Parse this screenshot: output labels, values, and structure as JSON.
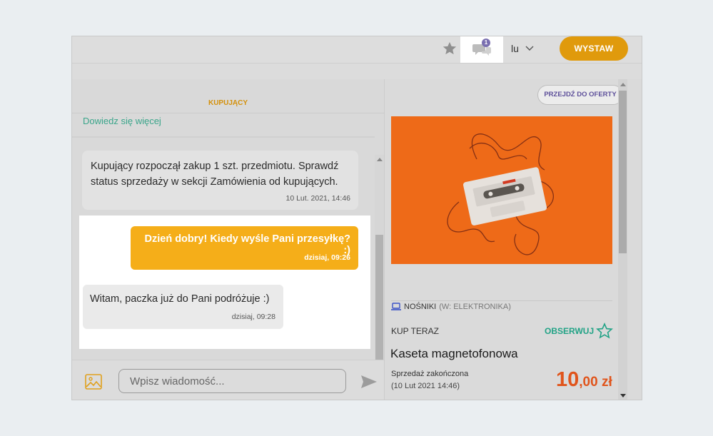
{
  "header": {
    "user_name": "lu",
    "publish_label": "WYSTAW",
    "unread_count": "1",
    "icons": {
      "favorites": "star-icon",
      "messages": "chat-bubbles-icon",
      "user_menu": "chevron-down-icon"
    },
    "accent_color": "#e09a0c"
  },
  "chat": {
    "role_label": "KUPUJĄCY",
    "learn_more_link": "Dowiedz się więcej",
    "system_message": {
      "text": "Kupujący rozpoczął zakup 1 szt. przedmiotu. Sprawdź status sprzedaży w sekcji Zamówienia od kupujących.",
      "time": "10 Lut. 2021, 14:46"
    },
    "messages": [
      {
        "direction": "outgoing",
        "text": "Dzień dobry! Kiedy wyśle Pani przesyłkę? :)",
        "time": "dzisiaj, 09:26"
      },
      {
        "direction": "incoming",
        "text": "Witam, paczka już do Pani podróżuje :)",
        "time": "dzisiaj, 09:28"
      }
    ],
    "composer": {
      "placeholder": "Wpisz wiadomość...",
      "icons": {
        "attach": "image-icon",
        "send": "send-icon"
      }
    }
  },
  "offer": {
    "go_to_offer_label": "PRZEJDŹ DO OFERTY",
    "image": "cassette-tape-photo",
    "category": "NOŚNIKI",
    "category_parent": "(W: ELEKTRONIKA)",
    "buy_type": "KUP TERAZ",
    "watch_label": "OBSERWUJ",
    "title": "Kaseta magnetofonowa",
    "sale_status": "Sprzedaż zakończona",
    "sale_date": "(10 Lut 2021 14:46)",
    "price_int": "10",
    "price_dec": ",00 zł",
    "price_color": "#e0541b",
    "watch_color": "#22a386"
  }
}
